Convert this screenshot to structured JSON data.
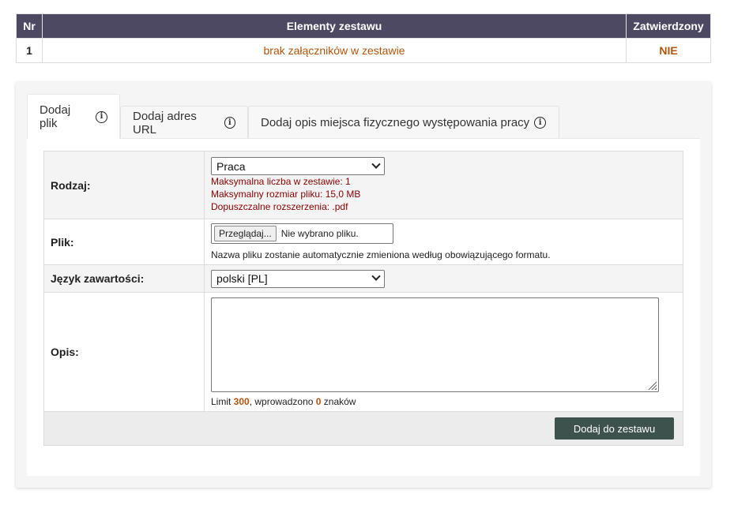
{
  "set_table": {
    "headers": [
      "Nr",
      "Elementy zestawu",
      "Zatwierdzony"
    ],
    "rows": [
      {
        "nr": "1",
        "element": "brak załączników w zestawie",
        "approved": "NIE"
      }
    ]
  },
  "tabs": [
    {
      "label": "Dodaj plik",
      "active": true
    },
    {
      "label": "Dodaj adres URL",
      "active": false
    },
    {
      "label": "Dodaj opis miejsca fizycznego występowania pracy",
      "active": false
    }
  ],
  "form": {
    "rodzaj": {
      "label": "Rodzaj:",
      "selected": "Praca",
      "notes": [
        "Maksymalna liczba w zestawie: 1",
        "Maksymalny rozmiar pliku: 15,0 MB",
        "Dopuszczalne rozszerzenia: .pdf"
      ]
    },
    "plik": {
      "label": "Plik:",
      "browse_label": "Przeglądaj...",
      "status": "Nie wybrano pliku.",
      "hint": "Nazwa pliku zostanie automatycznie zmieniona według obowiązującego formatu."
    },
    "jezyk": {
      "label": "Język zawartości:",
      "selected": "polski [PL]"
    },
    "opis": {
      "label": "Opis:",
      "value": "",
      "limit_prefix": "Limit ",
      "limit": "300",
      "limit_middle": ", wprowadzono ",
      "entered": "0",
      "limit_suffix": " znaków"
    },
    "submit_label": "Dodaj do zestawu"
  },
  "colors": {
    "header_bg": "#4d4963",
    "accent_orange": "#b4540a",
    "note_red": "#8b0000",
    "button_bg": "#3d524d"
  }
}
